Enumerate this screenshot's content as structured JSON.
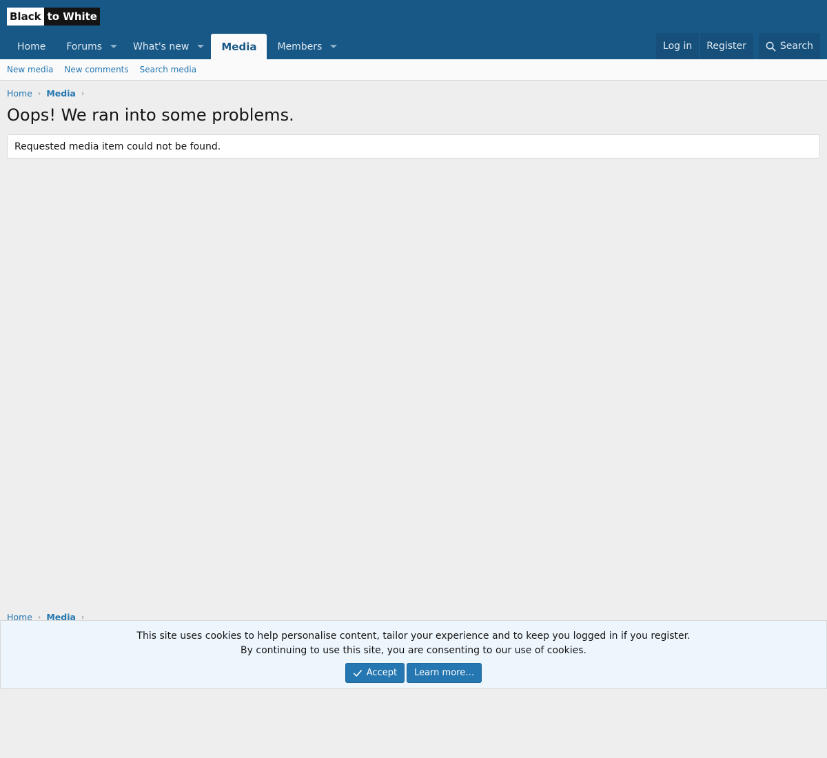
{
  "logo": {
    "part1": "Black",
    "part2": "to White"
  },
  "nav": {
    "home": "Home",
    "forums": "Forums",
    "whats_new": "What's new",
    "media": "Media",
    "members": "Members",
    "login": "Log in",
    "register": "Register",
    "search": "Search"
  },
  "subnav": {
    "new_media": "New media",
    "new_comments": "New comments",
    "search_media": "Search media"
  },
  "breadcrumb": {
    "home": "Home",
    "media": "Media"
  },
  "main": {
    "title": "Oops! We ran into some problems.",
    "message": "Requested media item could not be found."
  },
  "cookie": {
    "line1": "This site uses cookies to help personalise content, tailor your experience and to keep you logged in if you register.",
    "line2": "By continuing to use this site, you are consenting to our use of cookies.",
    "accept": "Accept",
    "learn_more": "Learn more…"
  },
  "colors": {
    "header": "#185886",
    "link": "#2577b1",
    "page_bg": "#eeeeee"
  }
}
